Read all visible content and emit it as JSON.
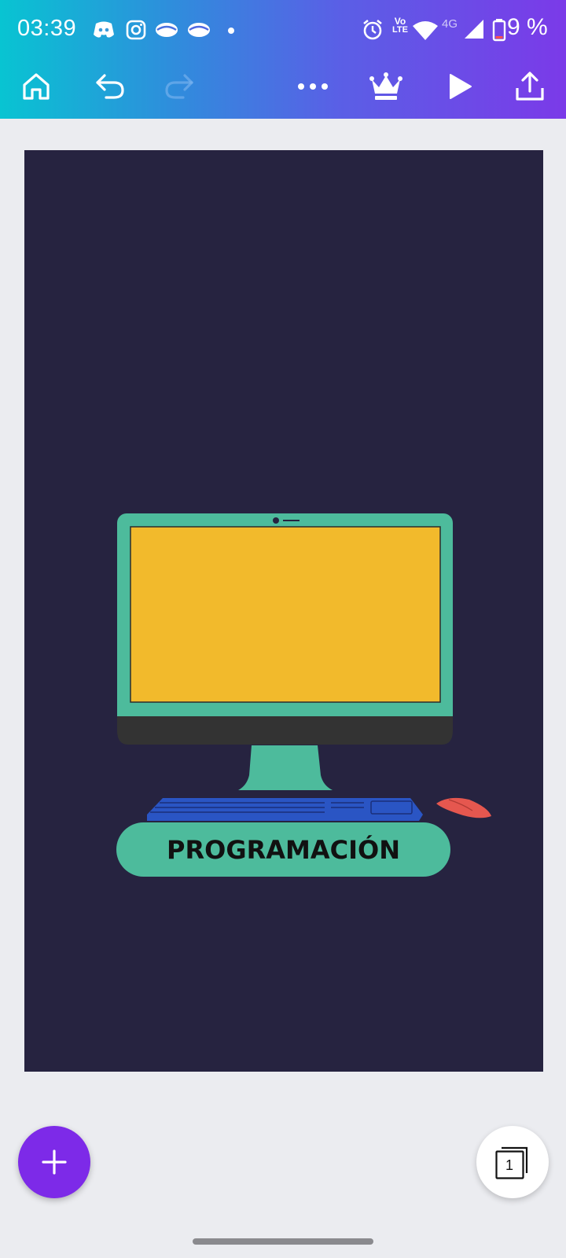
{
  "status_bar": {
    "time": "03:39",
    "battery": "9 %",
    "network_label": "4G",
    "volte_label_top": "Vo",
    "volte_label_bottom": "LTE",
    "icons": [
      "discord-icon",
      "instagram-icon",
      "eye-icon",
      "eye-icon",
      "dot-icon",
      "alarm-icon",
      "volte-icon",
      "wifi-icon",
      "signal-icon",
      "battery-icon"
    ]
  },
  "toolbar": {
    "icons": [
      "home-icon",
      "undo-icon",
      "redo-icon",
      "more-icon",
      "crown-icon",
      "play-icon",
      "share-icon"
    ]
  },
  "design": {
    "background_color": "#262340",
    "title": "PROGRAMACIÓN",
    "colors": {
      "monitor": "#4dbb9c",
      "screen": "#f2ba2c",
      "bezel": "#333333",
      "keyboard": "#2a55c4",
      "mouse": "#e5574f"
    }
  },
  "bottom": {
    "add_icon": "plus-icon",
    "pages_count": "1",
    "pages_icon": "pages-icon"
  },
  "colors": {
    "accent": "#7d2ae8",
    "gradient_start": "#08c4d2",
    "gradient_end": "#7b3ae8"
  }
}
